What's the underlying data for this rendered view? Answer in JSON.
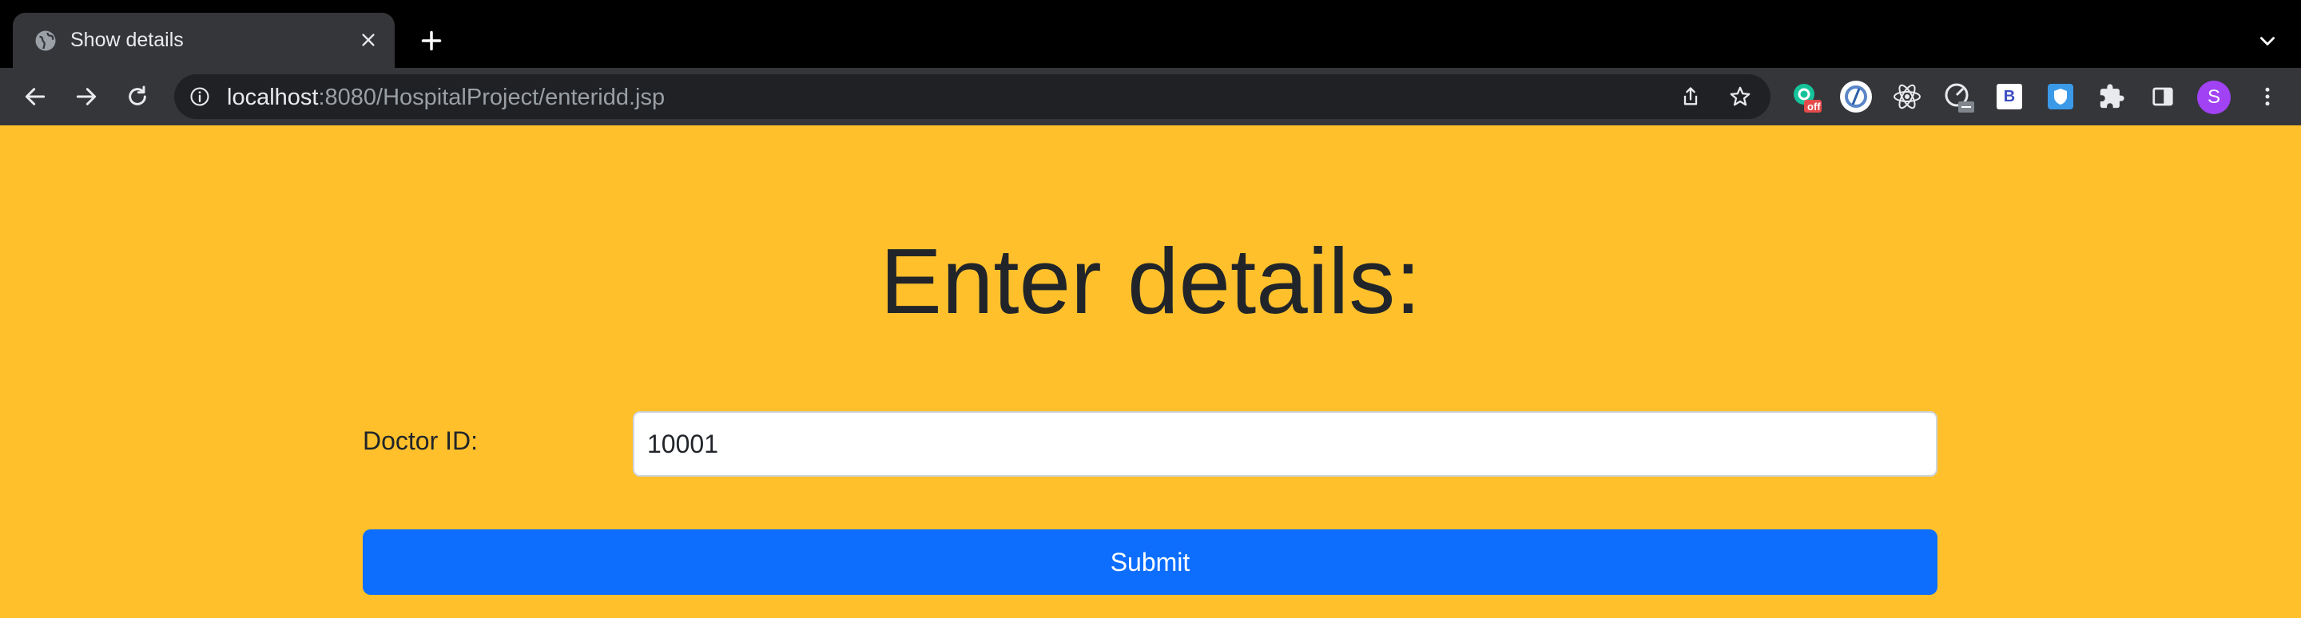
{
  "browser": {
    "tab": {
      "title": "Show details",
      "favicon": "globe-icon"
    },
    "url": {
      "host": "localhost",
      "rest": ":8080/HospitalProject/enteridd.jsp"
    },
    "extensions": [
      {
        "name": "grammarly-extension-icon",
        "badge": "off"
      },
      {
        "name": "circular-extension-icon"
      },
      {
        "name": "react-devtools-icon"
      },
      {
        "name": "lighthouse-extension-icon"
      },
      {
        "name": "b-extension-icon",
        "label": "B"
      },
      {
        "name": "shield-extension-icon"
      },
      {
        "name": "puzzle-extensions-icon"
      },
      {
        "name": "side-panel-icon"
      }
    ],
    "profile": {
      "initial": "S",
      "color": "#a142f4"
    }
  },
  "page": {
    "background": "#ffc02c",
    "heading": "Enter details:",
    "doctor_id_label": "Doctor ID:",
    "doctor_id_value": "10001",
    "submit_label": "Submit",
    "submit_color": "#0d6efd"
  }
}
